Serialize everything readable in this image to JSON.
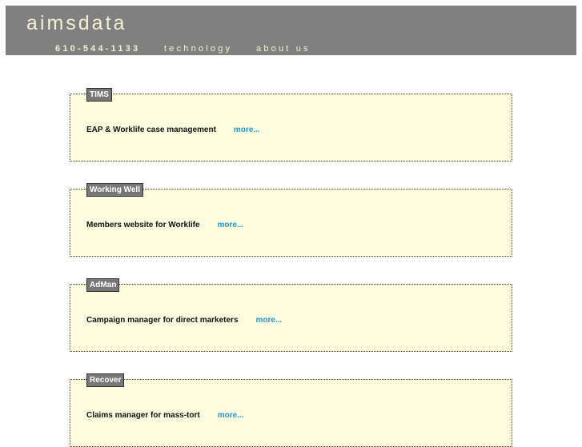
{
  "header": {
    "logo": "aimsdata",
    "phone": "610-544-1133",
    "nav": [
      "technology",
      "about us"
    ]
  },
  "products": [
    {
      "name": "TIMS",
      "description": "EAP & Worklife case management",
      "more": "more..."
    },
    {
      "name": "Working Well",
      "description": "Members website for Worklife",
      "more": "more..."
    },
    {
      "name": "AdMan",
      "description": "Campaign manager for direct marketers",
      "more": "more..."
    },
    {
      "name": "Recover",
      "description": "Claims manager for mass-tort",
      "more": "more..."
    }
  ]
}
